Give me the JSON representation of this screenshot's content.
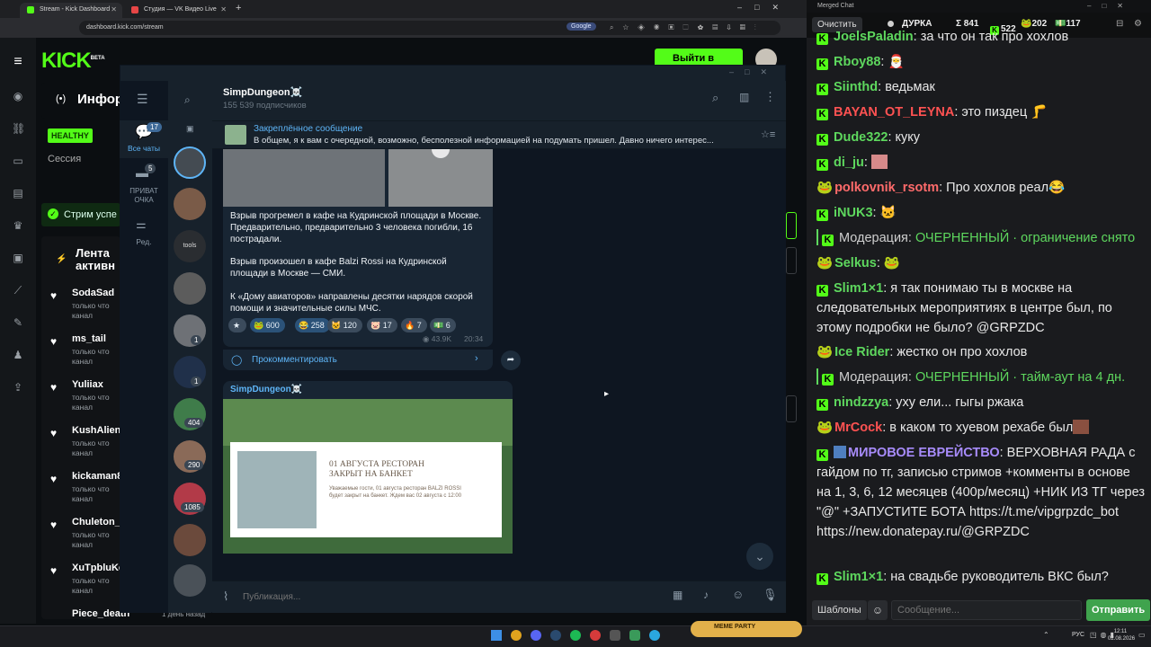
{
  "browser": {
    "tabs": [
      {
        "label": "Stream - Kick Dashboard",
        "active": true
      },
      {
        "label": "Студия — VK Видео Live",
        "active": false
      }
    ],
    "url": "dashboard.kick.com/stream",
    "search_engine": "Google"
  },
  "kick": {
    "logo": "KICK",
    "logo_sup": "BETA",
    "go_live": "Выйти в эфир",
    "info_title": "Инфор",
    "healthy": "HEALTHY",
    "session": "Сессия",
    "stream_status": "Стрим успе",
    "feed_title": "Лента активн",
    "feed": [
      {
        "name": "SodaSad",
        "l1": "только что",
        "l2": "канал"
      },
      {
        "name": "ms_tail",
        "l1": "только что",
        "l2": "канал"
      },
      {
        "name": "Yuliiax",
        "l1": "только что",
        "l2": "канал"
      },
      {
        "name": "KushAlien",
        "l1": "только что",
        "l2": "канал"
      },
      {
        "name": "kickaman8",
        "l1": "только что",
        "l2": "канал"
      },
      {
        "name": "Chuleton_",
        "l1": "только что",
        "l2": "канал"
      },
      {
        "name": "XuTpbluKo",
        "l1": "только что",
        "l2": "канал"
      },
      {
        "name": "Piece_death",
        "l1": "1 день назад",
        "l2": ""
      }
    ]
  },
  "telegram": {
    "channel_name": "SimpDungeon☠️",
    "subscribers": "155 539 подписчиков",
    "folders": [
      {
        "label": "Все чаты",
        "count": "17"
      },
      {
        "label": "ПРИВАТ ОЧКА",
        "count": "5"
      },
      {
        "label": "Ред.",
        "count": ""
      }
    ],
    "chat_badges": [
      "1",
      "1",
      "404",
      "290",
      "1085"
    ],
    "pinned_title": "Закреплённое сообщение",
    "pinned_text": "В общем, я к вам с очередной, возможно, бесполезной информацией на подумать пришел.  Давно ничего интерес...",
    "post1": {
      "p1": "Взрыв прогремел в кафе на Кудринской площади в Москве. Предварительно, предварительно 3 человека погибли, 16 пострадали.",
      "p2": "Взрыв произошел в кафе Balzi Rossi на Кудринской площади в Москве — СМИ.",
      "p3": "К «Дому авиаторов» направлены десятки нарядов скорой помощи и значительные силы МЧС.",
      "reactions": [
        "600",
        "258",
        "120",
        "17",
        "7",
        "6"
      ],
      "views": "43.9K",
      "time": "20:34",
      "comment": "Прокомментировать"
    },
    "post2": {
      "author": "SimpDungeon☠️",
      "img_title": "01 АВГУСТА РЕСТОРАН ЗАКРЫТ НА БАНКЕТ",
      "img_text": "Уважаемые гости, 01 августа ресторан BALZI ROSSI будет закрыт на банкет. Ждем вас 02 августа с 12:00"
    },
    "input_placeholder": "Публикация..."
  },
  "chat": {
    "window_title": "Merged Chat",
    "clear_button": "Очистить",
    "stats": {
      "name": "ДУРКА",
      "total": "Σ 841",
      "kick": "522",
      "other": "202",
      "vk": "117"
    },
    "lines": [
      {
        "user": "JoelsPaladin",
        "color": "#5ed85e",
        "text": ": за что он так про хохлов"
      },
      {
        "user": "Rboy88",
        "color": "#5ed85e",
        "text": ":"
      },
      {
        "user": "Siinthd",
        "color": "#5ed85e",
        "text": ": ведьмак"
      },
      {
        "user": "BAYAN_OT_LEYNA",
        "color": "#ff5252",
        "text": ": это пиздец"
      },
      {
        "user": "Dude322",
        "color": "#5ed85e",
        "text": ": куку"
      },
      {
        "user": "di_ju",
        "color": "#5ed85e",
        "text": ":"
      },
      {
        "user": "polkovnik_rsotm",
        "color": "#ff6b6b",
        "text": ": Про хохлов реал"
      },
      {
        "user": "iNUK3",
        "color": "#5ed85e",
        "text": ":"
      },
      {
        "user": "Модерация:",
        "color": "#cfcfcf",
        "text": " ОЧЕРНЕННЫЙ · ограничение снято",
        "mod": true
      },
      {
        "user": "Selkus",
        "color": "#5ed85e",
        "text": ":"
      },
      {
        "user": "Slim1×1",
        "color": "#5ed85e",
        "text": ": я так понимаю ты в москве на следовательных мероприятиях в центре был, по этому подробки не было? @GRPZDC"
      },
      {
        "user": "Ice Rider",
        "color": "#5ed85e",
        "text": ": жестко он про хохлов"
      },
      {
        "user": "Модерация:",
        "color": "#cfcfcf",
        "text": " ОЧЕРНЕННЫЙ · тайм-аут на 4 дн.",
        "mod": true
      },
      {
        "user": "nindzzya",
        "color": "#5ed85e",
        "text": ": ухy ели... гыгы ржака"
      },
      {
        "user": "MrCock",
        "color": "#ff5252",
        "text": ": в каком то хуевом рехабе был"
      },
      {
        "user": "МИРОВОЕ ЕВРЕЙСТВО",
        "color": "#a78bfa",
        "text": ": ВЕРХОВНАЯ РАДА с гайдом по тг, записью стримов +комменты в основе на 1, 3, 6, 12 месяцев (400р/месяц) +НИК ИЗ ТГ через \"@\" +ЗАПУСТИТЕ БОТА https://t.me/vipgrpzdc_bot https://new.donatepay.ru/@GRPZDC"
      },
      {
        "user": "Slim1×1",
        "color": "#5ed85e",
        "text": ": на свадьбе руководитель ВКС был?"
      }
    ],
    "templates_button": "Шаблоны",
    "message_placeholder": "Сообщение...",
    "send_button": "Отправить"
  },
  "taskbar": {
    "lang": "РУС",
    "time": "12:11",
    "date": "02.08.2026",
    "tray_label": "MEME PARTY"
  }
}
